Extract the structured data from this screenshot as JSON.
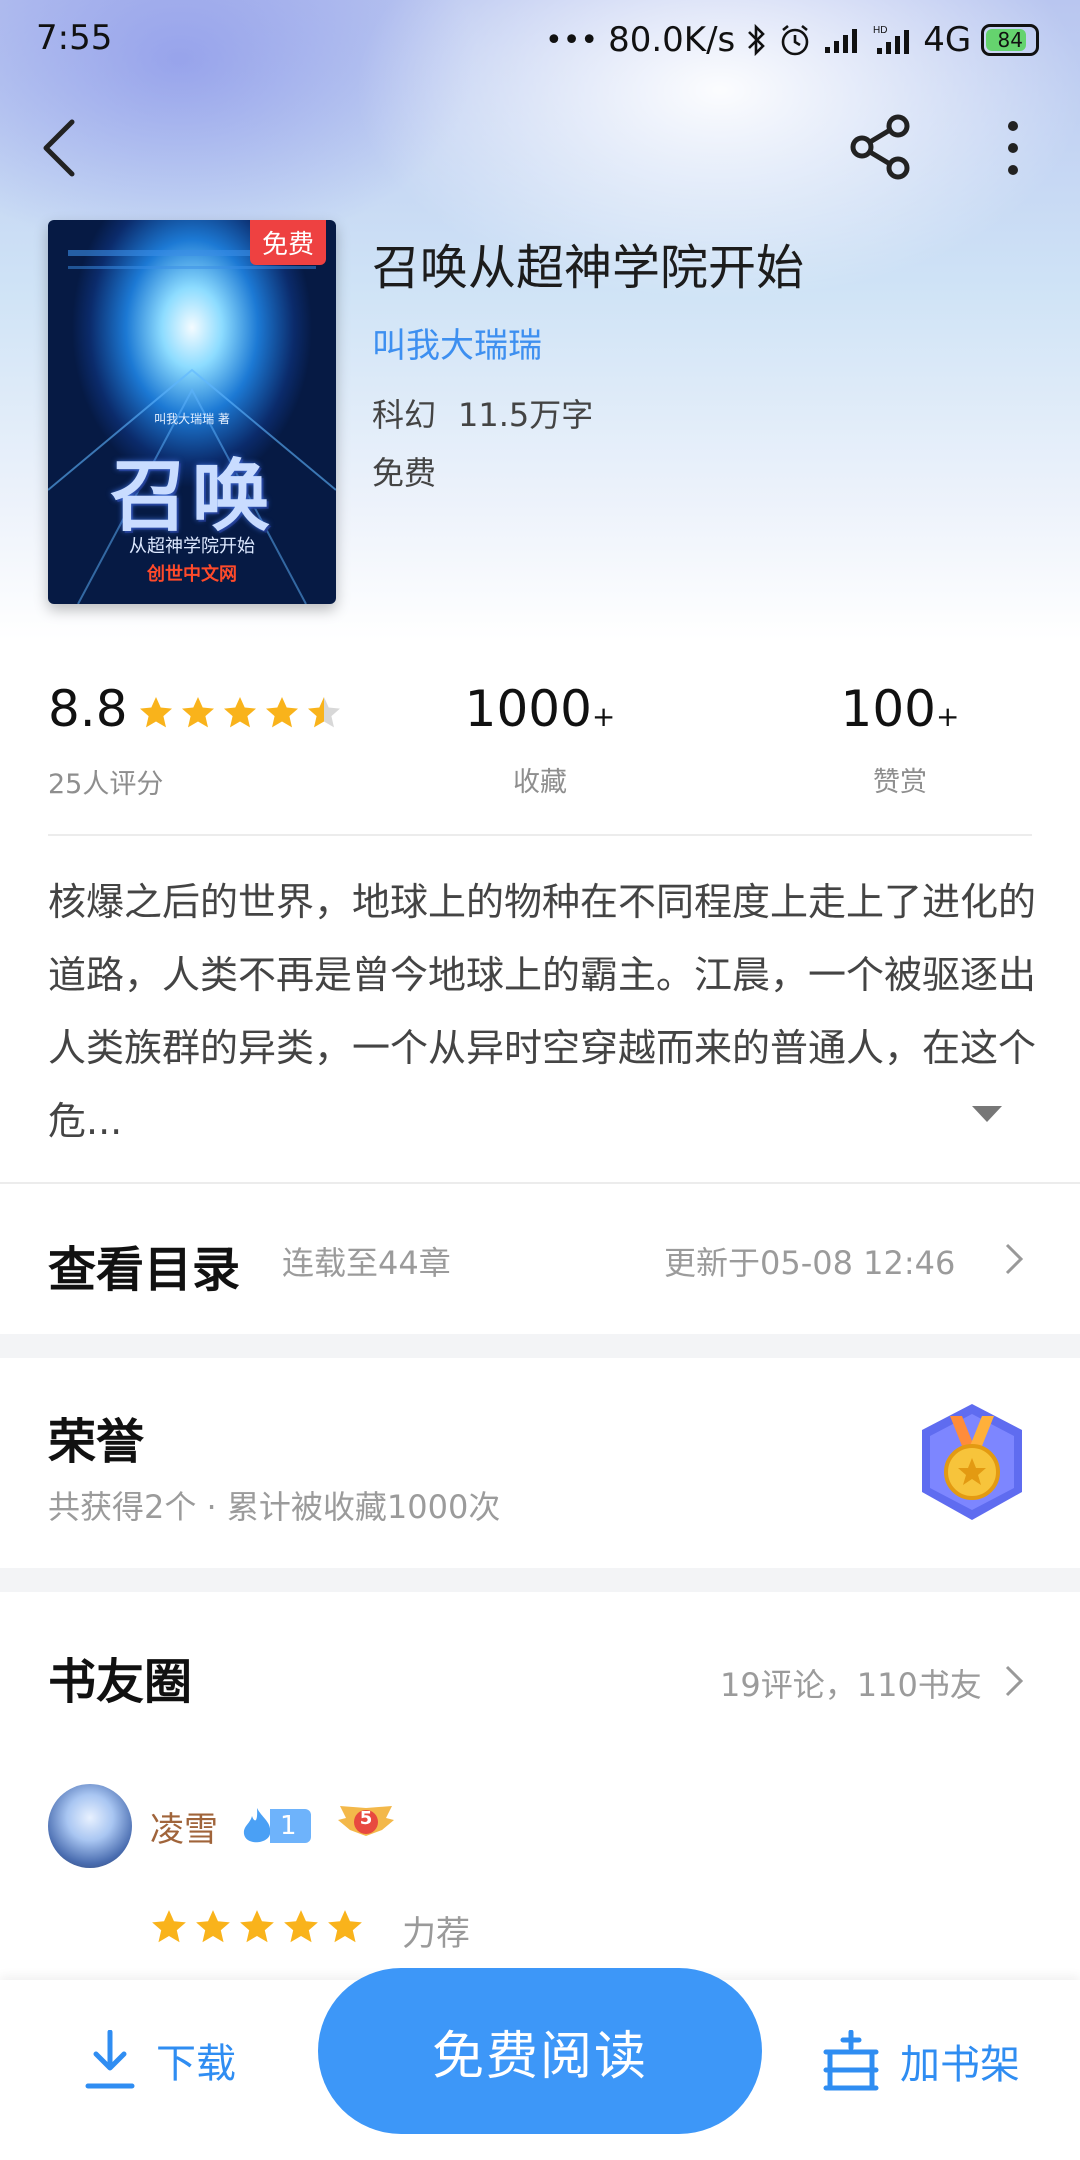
{
  "status_bar": {
    "time": "7:55",
    "network_speed": "80.0K/s",
    "network_type": "4G",
    "battery": "84"
  },
  "header": {
    "back_icon": "chevron-left-icon",
    "share_icon": "share-icon",
    "more_icon": "more-vertical-icon"
  },
  "book": {
    "cover_badge": "免费",
    "cover_title": "召唤",
    "cover_subtitle": "从超神学院开始",
    "cover_author": "叫我大瑞瑞 著",
    "cover_brand": "创世中文网",
    "title": "召唤从超神学院开始",
    "author": "叫我大瑞瑞",
    "genre": "科幻",
    "word_count": "11.5万字",
    "price": "免费"
  },
  "stats": {
    "rating": "8.8",
    "rating_stars": 4.5,
    "rating_count": "25人评分",
    "favorites": "1000",
    "favorites_suffix": "+",
    "favorites_label": "收藏",
    "rewards": "100",
    "rewards_suffix": "+",
    "rewards_label": "赞赏"
  },
  "synopsis": {
    "text": "核爆之后的世界，地球上的物种在不同程度上走上了进化的道路，人类不再是曾今地球上的霸主。江晨，一个被驱逐出人类族群的异类，一个从异时空穿越而来的普通人，在这个危...",
    "expand_icon": "caret-down-icon"
  },
  "catalog": {
    "title": "查看目录",
    "progress": "连载至44章",
    "updated": "更新于05-08 12:46"
  },
  "honor": {
    "title": "荣誉",
    "summary": "共获得2个 · 累计被收藏1000次",
    "medal_icon": "medal-icon"
  },
  "circle": {
    "title": "书友圈",
    "summary": "19评论，110书友",
    "comment": {
      "user_name": "凌雪",
      "fan_level": "1",
      "badge_level": "5",
      "stars": 5,
      "recommend_label": "力荐"
    }
  },
  "bottom_bar": {
    "download_label": "下载",
    "read_label": "免费阅读",
    "add_shelf_label": "加书架"
  },
  "colors": {
    "accent": "#3d97f8",
    "star": "#f9b31b",
    "badge_red": "#ee4141"
  }
}
